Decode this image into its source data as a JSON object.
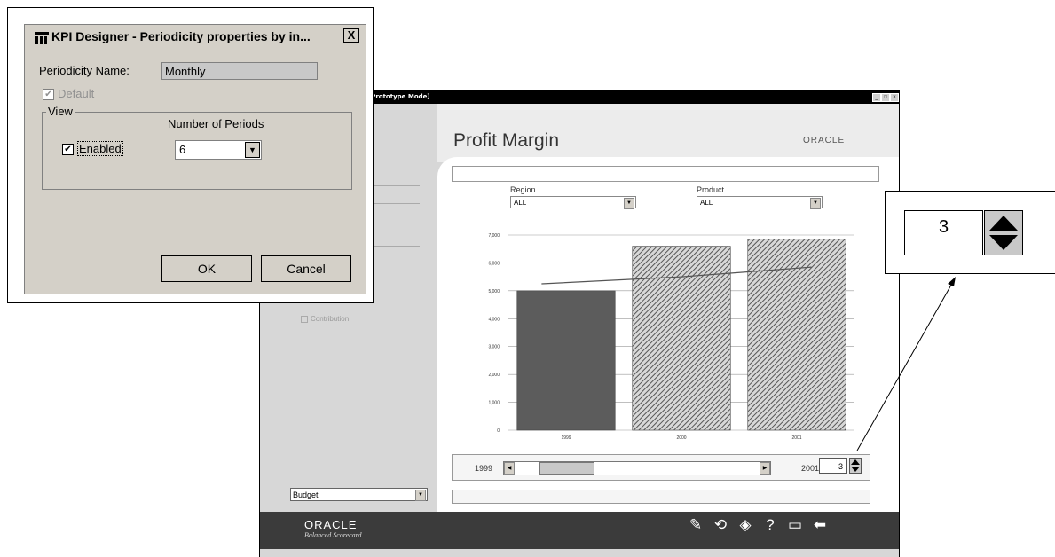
{
  "dialog": {
    "title": "KPI Designer - Periodicity properties by in...",
    "close_label": "X",
    "periodicity_name_label": "Periodicity Name:",
    "periodicity_name_value": "Monthly",
    "default_label": "Default",
    "default_checked": true,
    "view_group_label": "View",
    "enabled_label": "Enabled",
    "enabled_checked": true,
    "number_of_periods_label": "Number of Periods",
    "number_of_periods_value": "6",
    "ok_label": "OK",
    "cancel_label": "Cancel"
  },
  "scorecard": {
    "window_title": "[Prototype Mode]",
    "page_title": "Profit Margin",
    "brand": "ORACLE",
    "region_label": "Region",
    "region_value": "ALL",
    "product_label": "Product",
    "product_value": "ALL",
    "contribution_label": "Contribution",
    "budget_value": "Budget",
    "range_start": "1999",
    "range_end": "2001",
    "periods_stepper_value": "3",
    "footer_brand": "ORACLE",
    "footer_subtitle": "Balanced Scorecard"
  },
  "callout": {
    "stepper_value": "3"
  },
  "chart_data": {
    "type": "bar",
    "categories": [
      "1999",
      "2000",
      "2001"
    ],
    "series": [
      {
        "values": [
          5000,
          6600,
          6850
        ]
      }
    ],
    "target_line": [
      5250,
      5500,
      5850
    ],
    "y_ticks": [
      "0",
      "1,000",
      "2,000",
      "3,000",
      "4,000",
      "5,000",
      "6,000",
      "7,000"
    ],
    "ylim": [
      0,
      7000
    ],
    "grid": true,
    "colors": {
      "bar_solid": "#5c5c5c",
      "bar_hatched": "#6a6a6a",
      "line": "#555555"
    }
  }
}
